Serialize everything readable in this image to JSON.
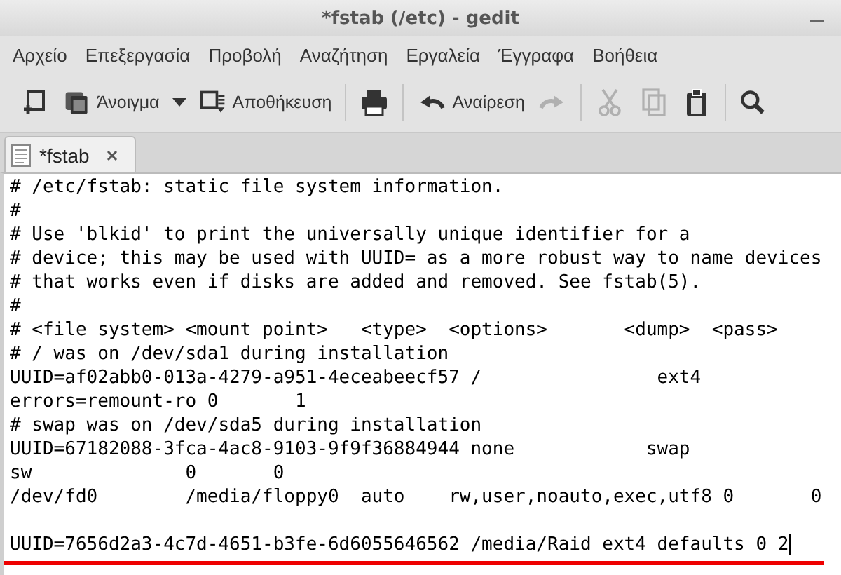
{
  "window": {
    "title": "*fstab (/etc) - gedit"
  },
  "menu": [
    "Αρχείο",
    "Επεξεργασία",
    "Προβολή",
    "Αναζήτηση",
    "Εργαλεία",
    "Έγγραφα",
    "Βοήθεια"
  ],
  "toolbar": [
    {
      "kind": "new",
      "disabled": false
    },
    {
      "kind": "open",
      "label": "Άνοιγμα",
      "disabled": false
    },
    {
      "kind": "open-menu",
      "disabled": false
    },
    {
      "kind": "save",
      "label": "Αποθήκευση",
      "disabled": false
    },
    {
      "kind": "separator"
    },
    {
      "kind": "print",
      "disabled": false
    },
    {
      "kind": "separator"
    },
    {
      "kind": "undo",
      "label": "Αναίρεση",
      "disabled": false
    },
    {
      "kind": "redo",
      "disabled": true
    },
    {
      "kind": "separator"
    },
    {
      "kind": "cut",
      "disabled": true
    },
    {
      "kind": "copy",
      "disabled": true
    },
    {
      "kind": "paste",
      "disabled": false
    },
    {
      "kind": "separator"
    },
    {
      "kind": "find",
      "disabled": false
    }
  ],
  "tabs": [
    {
      "label": "*fstab",
      "selected": true
    }
  ],
  "editor": {
    "lines": [
      {
        "kind": "text",
        "text": "# /etc/fstab: static file system information.",
        "cursor": false,
        "underlined": false
      },
      {
        "kind": "text",
        "text": "#",
        "cursor": false,
        "underlined": false
      },
      {
        "kind": "text",
        "text": "# Use 'blkid' to print the universally unique identifier for a",
        "cursor": false,
        "underlined": false
      },
      {
        "kind": "text",
        "text": "# device; this may be used with UUID= as a more robust way to name devices",
        "cursor": false,
        "underlined": false
      },
      {
        "kind": "text",
        "text": "# that works even if disks are added and removed. See fstab(5).",
        "cursor": false,
        "underlined": false
      },
      {
        "kind": "text",
        "text": "#",
        "cursor": false,
        "underlined": false
      },
      {
        "kind": "text",
        "text": "# <file system> <mount point>   <type>  <options>       <dump>  <pass>",
        "cursor": false,
        "underlined": false
      },
      {
        "kind": "text",
        "text": "# / was on /dev/sda1 during installation",
        "cursor": false,
        "underlined": false
      },
      {
        "kind": "text",
        "text": "UUID=af02abb0-013a-4279-a951-4eceabeecf57 /                ext4",
        "cursor": false,
        "underlined": false
      },
      {
        "kind": "text",
        "text": "errors=remount-ro 0       1",
        "cursor": false,
        "underlined": false
      },
      {
        "kind": "text",
        "text": "# swap was on /dev/sda5 during installation",
        "cursor": false,
        "underlined": false
      },
      {
        "kind": "text",
        "text": "UUID=67182088-3fca-4ac8-9103-9f9f36884944 none            swap",
        "cursor": false,
        "underlined": false
      },
      {
        "kind": "text",
        "text": "sw              0       0",
        "cursor": false,
        "underlined": false
      },
      {
        "kind": "text",
        "text": "/dev/fd0        /media/floppy0  auto    rw,user,noauto,exec,utf8 0       0",
        "cursor": false,
        "underlined": false
      },
      {
        "kind": "blank"
      },
      {
        "kind": "text",
        "text": "UUID=7656d2a3-4c7d-4651-b3fe-6d6055646562 /media/Raid ext4 defaults 0 2",
        "cursor": true,
        "underlined": true
      }
    ]
  }
}
